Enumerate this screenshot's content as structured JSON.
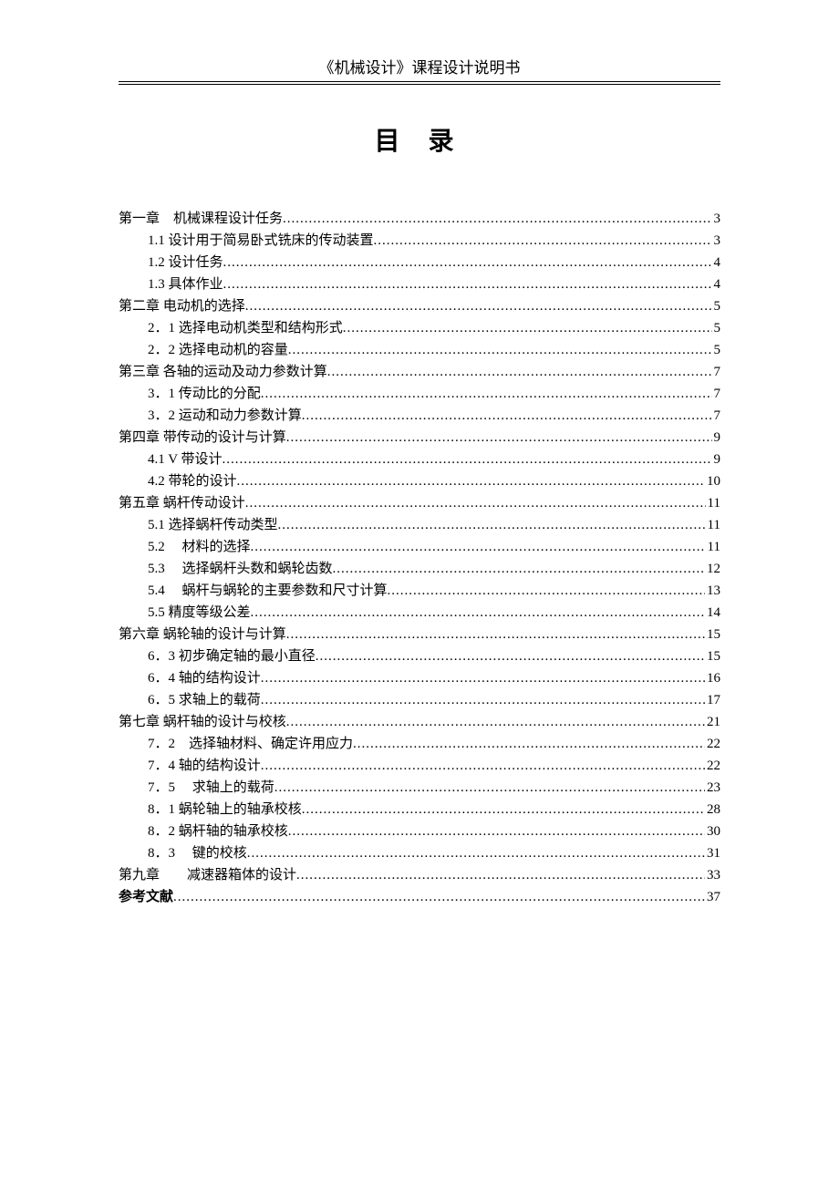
{
  "header": "《机械设计》课程设计说明书",
  "toc_title": "目 录",
  "toc": [
    {
      "label": "第一章　机械课程设计任务",
      "page": "3",
      "indent": 0
    },
    {
      "label": "1.1 设计用于简易卧式铣床的传动装置",
      "page": "3",
      "indent": 1
    },
    {
      "label": "1.2  设计任务",
      "page": "4",
      "indent": 1
    },
    {
      "label": "1.3  具体作业",
      "page": "4",
      "indent": 1
    },
    {
      "label": "第二章  电动机的选择",
      "page": "5",
      "indent": 0
    },
    {
      "label": "2．1 选择电动机类型和结构形式",
      "page": "5",
      "indent": 1
    },
    {
      "label": "2．2 选择电动机的容量",
      "page": "5",
      "indent": 1
    },
    {
      "label": "第三章  各轴的运动及动力参数计算",
      "page": "7",
      "indent": 0
    },
    {
      "label": "3．1  传动比的分配",
      "page": "7",
      "indent": 1
    },
    {
      "label": "3．2  运动和动力参数计算",
      "page": "7",
      "indent": 1
    },
    {
      "label": "第四章  带传动的设计与计算",
      "page": "9",
      "indent": 0
    },
    {
      "label": "4.1 V 带设计",
      "page": "9",
      "indent": 1
    },
    {
      "label": "4.2  带轮的设计",
      "page": "10",
      "indent": 1
    },
    {
      "label": "第五章  蜗杆传动设计",
      "page": "11",
      "indent": 0
    },
    {
      "label": "5.1  选择蜗杆传动类型",
      "page": "11",
      "indent": 1
    },
    {
      "label": "5.2　 材料的选择",
      "page": "11",
      "indent": 1
    },
    {
      "label": "5.3 　选择蜗杆头数和蜗轮齿数",
      "page": "12",
      "indent": 1
    },
    {
      "label": "5.4 　蜗杆与蜗轮的主要参数和尺寸计算",
      "page": "13",
      "indent": 1
    },
    {
      "label": "5.5  精度等级公差",
      "page": "14",
      "indent": 1
    },
    {
      "label": "第六章  蜗轮轴的设计与计算",
      "page": "15",
      "indent": 0
    },
    {
      "label": "6．3  初步确定轴的最小直径",
      "page": "15",
      "indent": 1
    },
    {
      "label": "6．4  轴的结构设计",
      "page": "16",
      "indent": 1
    },
    {
      "label": "6．5  求轴上的载荷",
      "page": "17",
      "indent": 1
    },
    {
      "label": "第七章  蜗杆轴的设计与校核",
      "page": "21",
      "indent": 0
    },
    {
      "label": "7．2　选择轴材料、确定许用应力",
      "page": "22",
      "indent": 1
    },
    {
      "label": "7．4  轴的结构设计",
      "page": "22",
      "indent": 1
    },
    {
      "label": "7．5　 求轴上的载荷",
      "page": "23",
      "indent": 1
    },
    {
      "label": "8．1  蜗轮轴上的轴承校核",
      "page": "28",
      "indent": 1
    },
    {
      "label": "8．2  蜗杆轴的轴承校核",
      "page": "30",
      "indent": 1
    },
    {
      "label": "8．3　 键的校核",
      "page": "31",
      "indent": 1
    },
    {
      "label": "第九章　　减速器箱体的设计",
      "page": "33",
      "indent": 0
    },
    {
      "label": "参考文献",
      "page": "37",
      "indent": 0,
      "bold": true
    }
  ]
}
